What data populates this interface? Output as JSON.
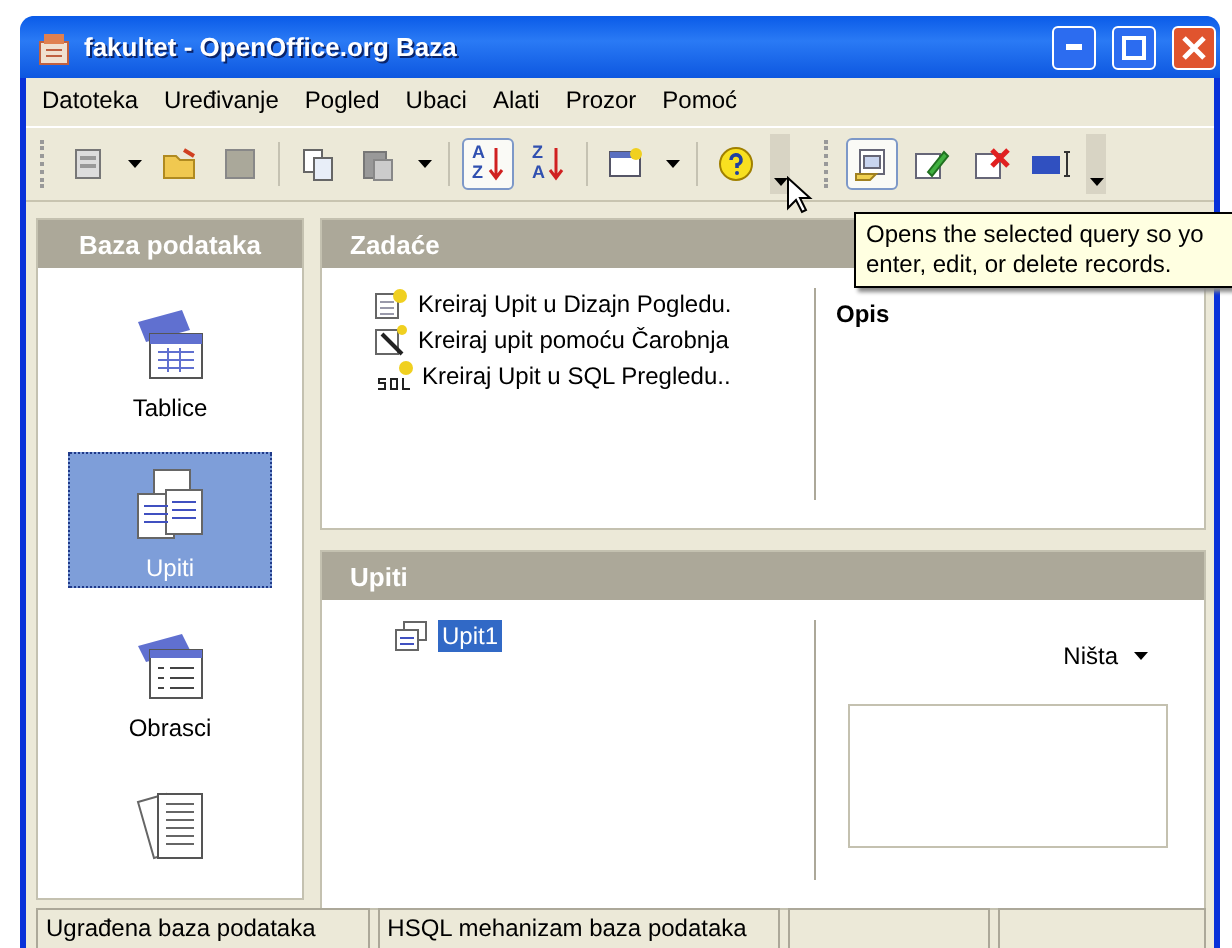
{
  "window": {
    "title": "fakultet - OpenOffice.org Baza"
  },
  "menu": [
    {
      "label": "Datoteka"
    },
    {
      "label": "Uređivanje"
    },
    {
      "label": "Pogled"
    },
    {
      "label": "Ubaci"
    },
    {
      "label": "Alati"
    },
    {
      "label": "Prozor"
    },
    {
      "label": "Pomoć"
    }
  ],
  "toolbars": [
    {
      "groups": [
        [
          {
            "kind": "new",
            "menu": true,
            "pressed": false
          },
          {
            "kind": "open",
            "pressed": false
          },
          {
            "kind": "save",
            "pressed": false
          }
        ],
        [
          {
            "kind": "copy",
            "pressed": false
          },
          {
            "kind": "paste",
            "menu": true,
            "pressed": false
          }
        ],
        [
          {
            "kind": "sort",
            "glyphs": [
              "A",
              "Z"
            ],
            "pressed": true
          },
          {
            "kind": "sort",
            "glyphs": [
              "Z",
              "A"
            ],
            "pressed": false
          }
        ],
        [
          {
            "kind": "form",
            "menu": true,
            "pressed": false
          }
        ],
        [
          {
            "kind": "help",
            "pressed": false
          }
        ]
      ]
    },
    {
      "groups": [
        [
          {
            "kind": "open-query",
            "pressed": true
          },
          {
            "kind": "edit",
            "pressed": false
          },
          {
            "kind": "delete",
            "pressed": false
          },
          {
            "kind": "rename",
            "pressed": false
          }
        ]
      ]
    }
  ],
  "sidebar": {
    "title": "Baza podataka",
    "items": [
      {
        "label": "Tablice",
        "kind": "tables",
        "selected": false
      },
      {
        "label": "Upiti",
        "kind": "queries",
        "selected": true
      },
      {
        "label": "Obrasci",
        "kind": "forms",
        "selected": false
      },
      {
        "kind": "reports",
        "selected": false
      }
    ]
  },
  "tasks": {
    "title": "Zadaće",
    "items": [
      {
        "label": "Kreiraj Upit u Dizajn Pogledu.",
        "kind": "design"
      },
      {
        "label": "Kreiraj upit pomoću Čarobnja",
        "kind": "wizard"
      },
      {
        "label": "Kreiraj Upit u SQL Pregledu..",
        "kind": "sql"
      }
    ],
    "description_title": "Opis"
  },
  "queries": {
    "title": "Upiti",
    "items": [
      {
        "label": "Upit1",
        "selected": true
      }
    ],
    "preview_mode": "Ništa"
  },
  "status_bar": [
    {
      "text": "Ugrađena baza podataka"
    },
    {
      "text": "HSQL mehanizam baza podataka"
    }
  ],
  "tooltip": {
    "lines": [
      "Opens the selected query so yo",
      "enter, edit, or delete records."
    ]
  }
}
